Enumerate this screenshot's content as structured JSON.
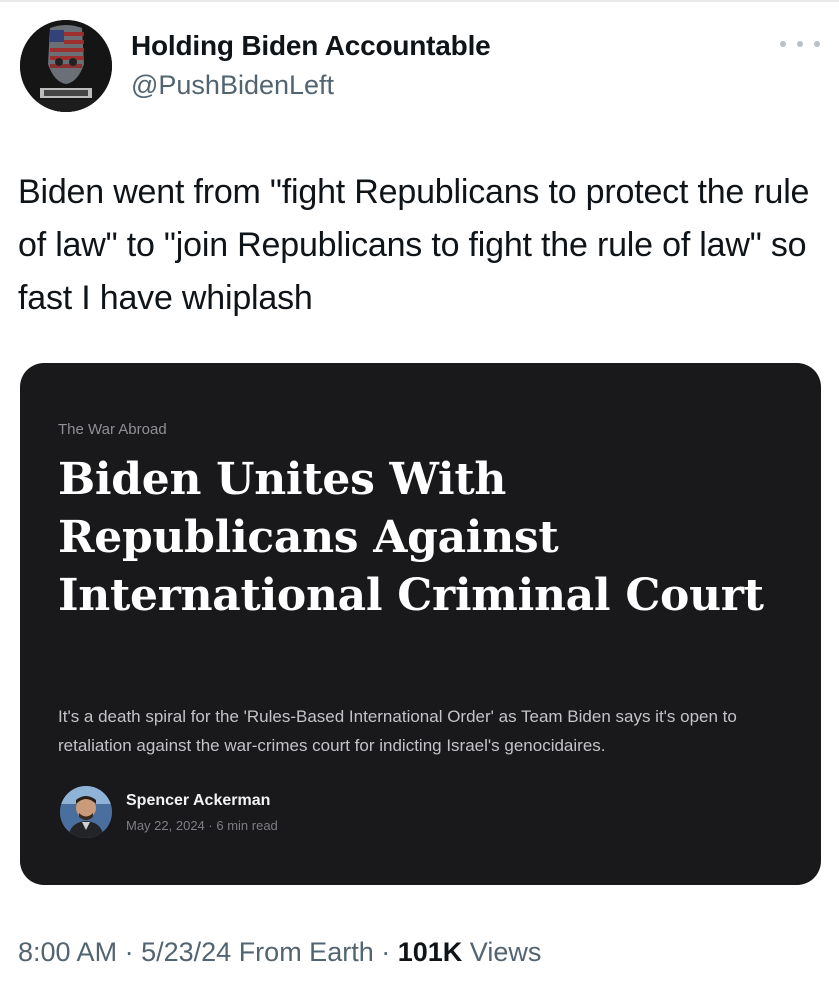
{
  "author": {
    "display_name": "Holding Biden Accountable",
    "handle": "@PushBidenLeft",
    "avatar_icon": "flag-avatar-icon"
  },
  "tweet": {
    "text": "Biden went from \"fight Republicans to protect the rule of law\" to \"join Republicans to fight the rule of law\" so fast I have whiplash"
  },
  "card": {
    "section": "The War Abroad",
    "headline": "Biden Unites With Republicans Against International Criminal Court",
    "subtitle": "It's a death spiral for the 'Rules-Based International Order' as Team Biden says it's open to retaliation against the war-crimes court for indicting Israel's genocidaires.",
    "author_name": "Spencer Ackerman",
    "date": "May 22, 2024",
    "read_time": "6 min read",
    "background_color": "#19191c"
  },
  "meta": {
    "time": "8:00 AM",
    "date": "5/23/24",
    "source": "From Earth",
    "views_count": "101K",
    "views_label": "Views"
  },
  "colors": {
    "text_primary": "#0f1419",
    "text_secondary": "#536471"
  }
}
